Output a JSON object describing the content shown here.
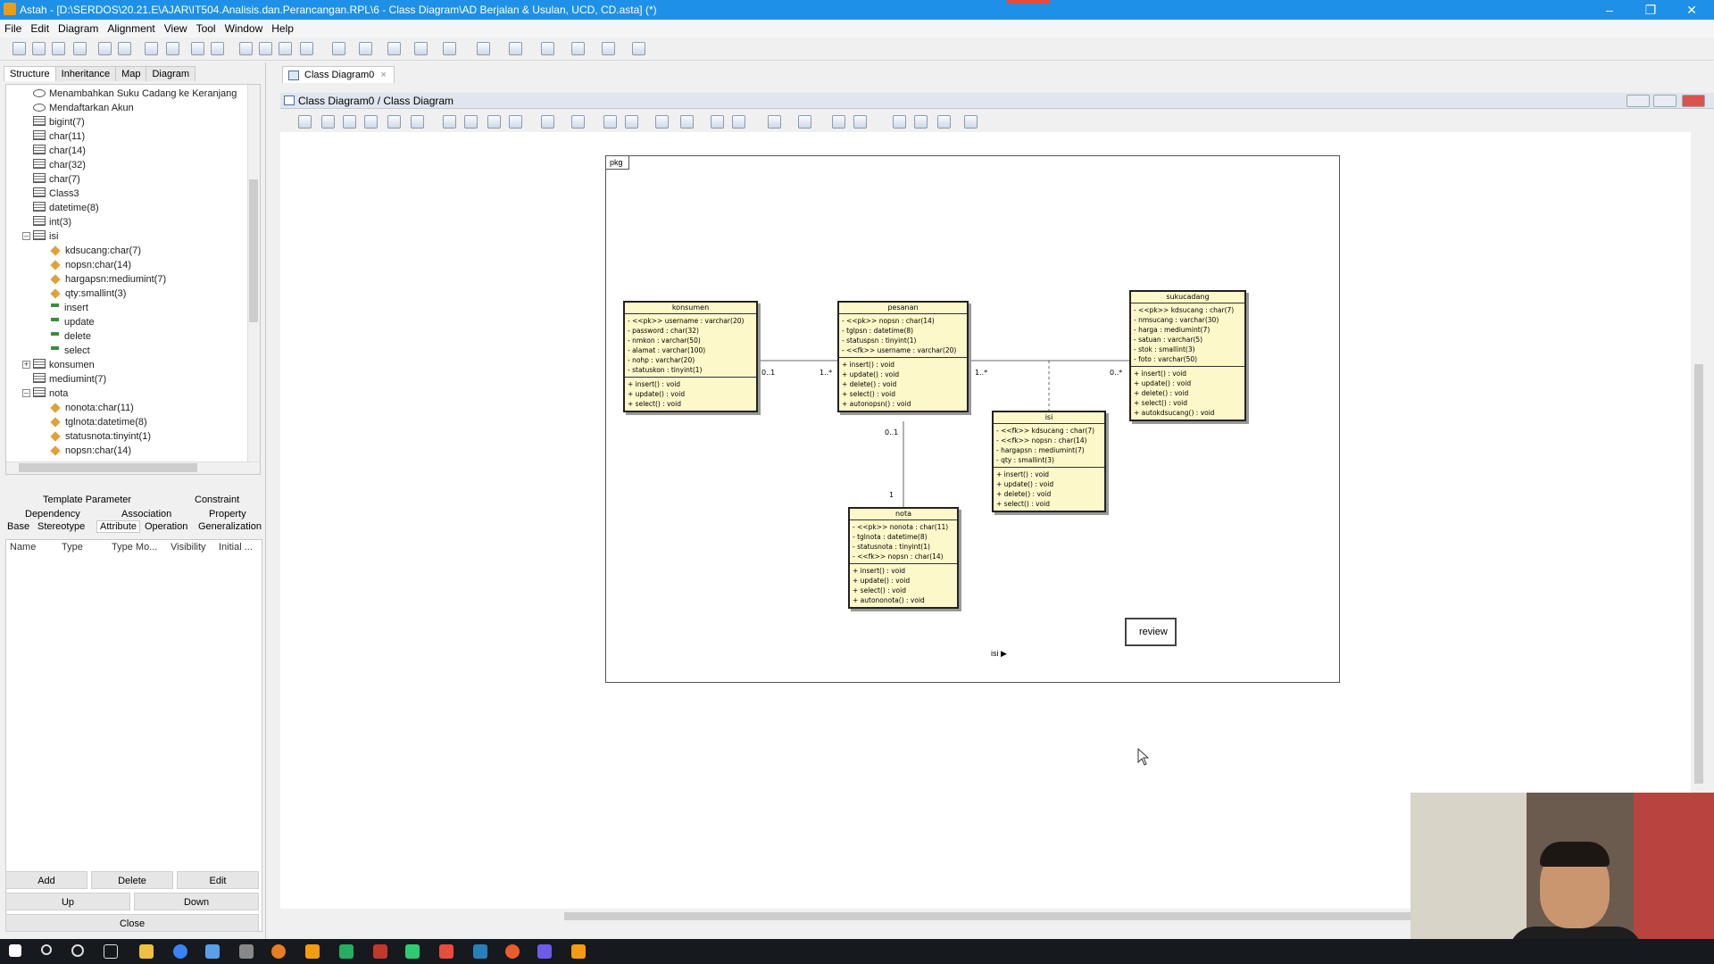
{
  "window": {
    "title": "Astah - [D:\\SERDOS\\20.21.E\\AJAR\\IT504.Analisis.dan.Perancangan.RPL\\6 - Class Diagram\\AD Berjalan & Usulan, UCD, CD.asta] (*)",
    "controls": [
      "–",
      "❐",
      "✕"
    ]
  },
  "menu": [
    "File",
    "Edit",
    "Diagram",
    "Alignment",
    "View",
    "Tool",
    "Window",
    "Help"
  ],
  "left_panel": {
    "tabs": [
      "Structure",
      "Inheritance",
      "Map",
      "Diagram"
    ],
    "tree": [
      {
        "label": "Menambahkan Suku Cadang ke Keranjang",
        "icon": "usecase",
        "indent": 1
      },
      {
        "label": "Mendaftarkan Akun",
        "icon": "usecase",
        "indent": 1
      },
      {
        "label": "bigint(7)",
        "icon": "table",
        "indent": 1
      },
      {
        "label": "char(11)",
        "icon": "table",
        "indent": 1
      },
      {
        "label": "char(14)",
        "icon": "table",
        "indent": 1
      },
      {
        "label": "char(32)",
        "icon": "table",
        "indent": 1
      },
      {
        "label": "char(7)",
        "icon": "table",
        "indent": 1
      },
      {
        "label": "Class3",
        "icon": "table",
        "indent": 1
      },
      {
        "label": "datetime(8)",
        "icon": "table",
        "indent": 1
      },
      {
        "label": "int(3)",
        "icon": "table",
        "indent": 1
      },
      {
        "label": "isi",
        "icon": "table",
        "indent": 1,
        "expander": "–"
      },
      {
        "label": "kdsucang:char(7)",
        "icon": "attr",
        "indent": 2
      },
      {
        "label": "nopsn:char(14)",
        "icon": "attr",
        "indent": 2
      },
      {
        "label": "hargapsn:mediumint(7)",
        "icon": "attr",
        "indent": 2
      },
      {
        "label": "qty:smallint(3)",
        "icon": "attr",
        "indent": 2
      },
      {
        "label": "insert",
        "icon": "op",
        "indent": 2
      },
      {
        "label": "update",
        "icon": "op",
        "indent": 2
      },
      {
        "label": "delete",
        "icon": "op",
        "indent": 2
      },
      {
        "label": "select",
        "icon": "op",
        "indent": 2
      },
      {
        "label": "konsumen",
        "icon": "table",
        "indent": 1,
        "expander": "+"
      },
      {
        "label": "mediumint(7)",
        "icon": "table",
        "indent": 1
      },
      {
        "label": "nota",
        "icon": "table",
        "indent": 1,
        "expander": "–"
      },
      {
        "label": "nonota:char(11)",
        "icon": "attr",
        "indent": 2
      },
      {
        "label": "tglnota:datetime(8)",
        "icon": "attr",
        "indent": 2
      },
      {
        "label": "statusnota:tinyint(1)",
        "icon": "attr",
        "indent": 2
      },
      {
        "label": "nopsn:char(14)",
        "icon": "attr",
        "indent": 2
      }
    ],
    "prop_tabs_row1": [
      "Template Parameter",
      "Constraint"
    ],
    "prop_tabs_row2": [
      "Dependency",
      "Association",
      "Property"
    ],
    "prop_tabs_row3": [
      "Base",
      "Stereotype",
      "Attribute",
      "Operation",
      "Generalization"
    ],
    "table_columns": [
      "Name",
      "Type",
      "Type Mo...",
      "Visibility",
      "Initial ..."
    ],
    "buttons": {
      "add": "Add",
      "delete": "Delete",
      "edit": "Edit",
      "up": "Up",
      "down": "Down",
      "close": "Close"
    }
  },
  "editor": {
    "tab_label": "Class Diagram0",
    "tab_close": "×",
    "inner_title": "Class Diagram0 / Class Diagram",
    "package_label": "pkg"
  },
  "classes": {
    "konsumen": {
      "name": "konsumen",
      "attributes": [
        "- <<pk>> username : varchar(20)",
        "- password : char(32)",
        "- nmkon : varchar(50)",
        "- alamat : varchar(100)",
        "- nohp : varchar(20)",
        "- statuskon : tinyint(1)"
      ],
      "operations": [
        "+ insert() : void",
        "+ update() : void",
        "+ select() : void"
      ]
    },
    "pesanan": {
      "name": "pesanan",
      "attributes": [
        "- <<pk>> nopsn : char(14)",
        "- tglpsn : datetime(8)",
        "- statuspsn : tinyint(1)",
        "- <<fk>> username : varchar(20)"
      ],
      "operations": [
        "+ insert() : void",
        "+ update() : void",
        "+ delete() : void",
        "+ select() : void",
        "+ autonopsn() : void"
      ]
    },
    "sukucadang": {
      "name": "sukucadang",
      "attributes": [
        "- <<pk>> kdsucang : char(7)",
        "- nmsucang : varchar(30)",
        "- harga : mediumint(7)",
        "- satuan : varchar(5)",
        "- stok : smallint(3)",
        "- foto : varchar(50)"
      ],
      "operations": [
        "+ insert() : void",
        "+ update() : void",
        "+ delete() : void",
        "+ select() : void",
        "+ autokdsucang() : void"
      ]
    },
    "isi": {
      "name": "isi",
      "attributes": [
        "- <<fk>> kdsucang : char(7)",
        "- <<fk>> nopsn : char(14)",
        "- hargapsn : mediumint(7)",
        "- qty : smallint(3)"
      ],
      "operations": [
        "+ insert() : void",
        "+ update() : void",
        "+ delete() : void",
        "+ select() : void"
      ]
    },
    "nota": {
      "name": "nota",
      "attributes": [
        "- <<pk>> nonota : char(11)",
        "- tglnota : datetime(8)",
        "- statusnota : tinyint(1)",
        "- <<fk>> nopsn : char(14)"
      ],
      "operations": [
        "+ insert() : void",
        "+ update() : void",
        "+ select() : void",
        "+ autononota() : void"
      ]
    }
  },
  "multiplicities": {
    "konsumen_side": "0..1",
    "pesanan_left": "1..*",
    "pesanan_right": "1..*",
    "sukucadang_side": "0..*",
    "pesanan_bottom": "0..1",
    "nota_top": "1"
  },
  "note": {
    "text": "review"
  },
  "canvas_marker": "isi ▶"
}
